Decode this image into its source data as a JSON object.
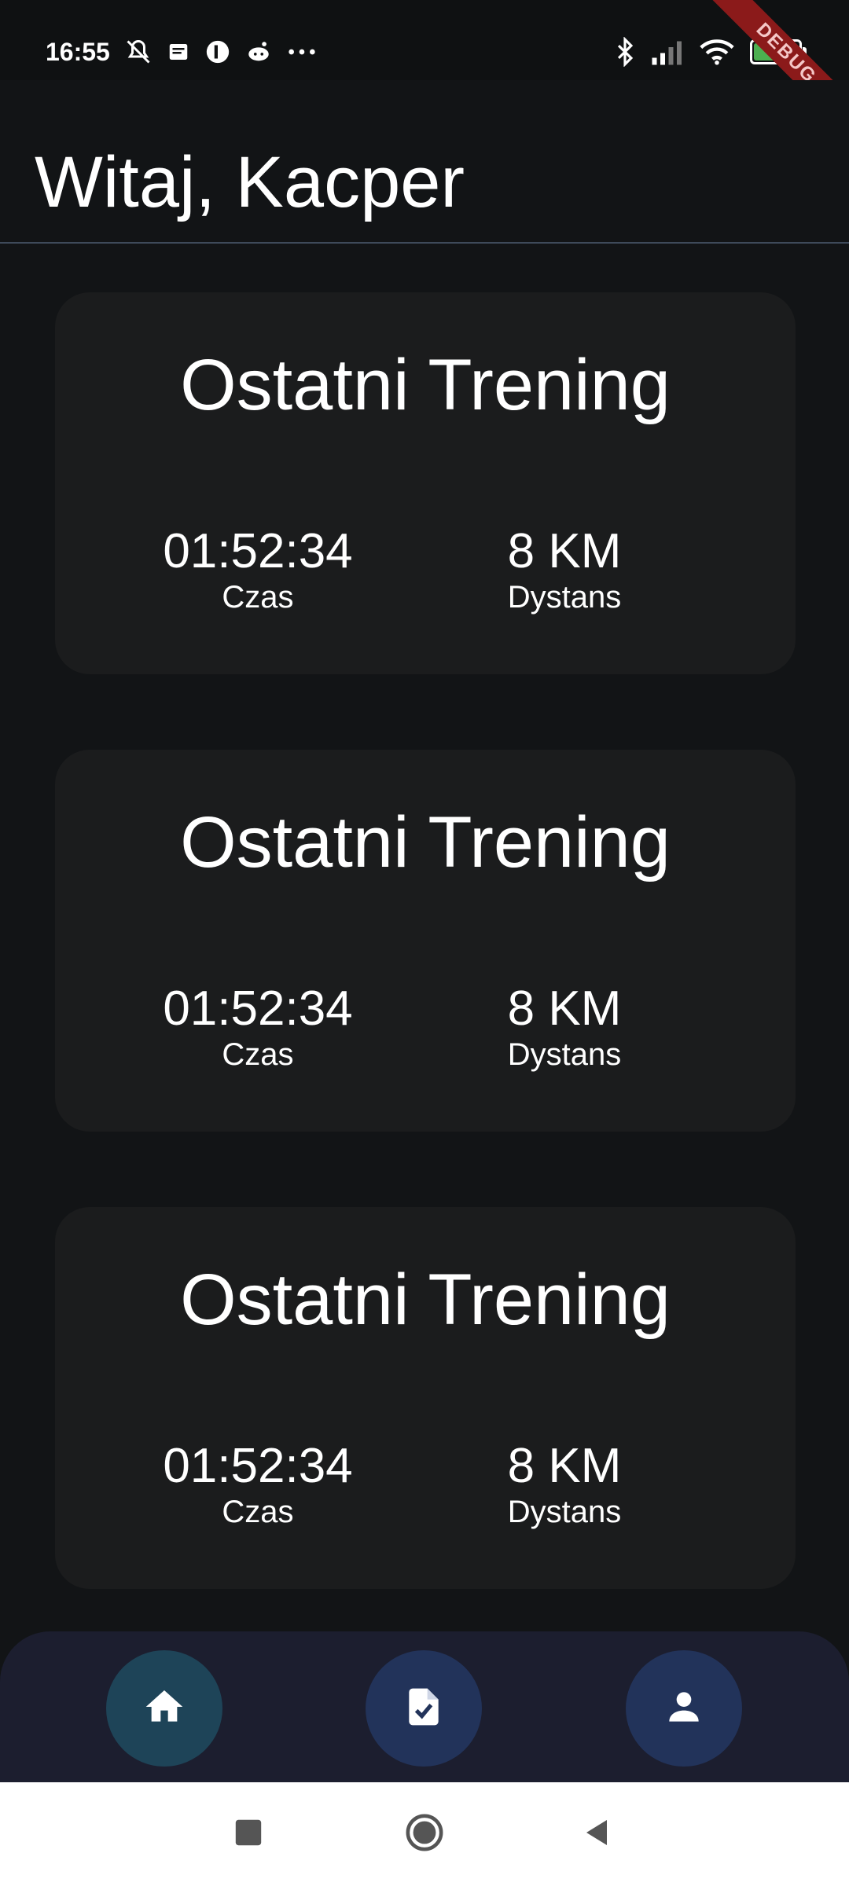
{
  "status_bar": {
    "time": "16:55",
    "battery_text": "92",
    "battery_level": 0.92,
    "left_icons": [
      "muted-bell-icon",
      "message-icon",
      "app-circle-icon",
      "reddit-icon",
      "more-dots-icon"
    ],
    "right_icons": [
      "bluetooth-icon",
      "signal-icon",
      "wifi-icon",
      "battery-icon"
    ]
  },
  "debug_banner": "DEBUG",
  "app_bar": {
    "title": "Witaj, Kacper"
  },
  "cards": [
    {
      "title": "Ostatni Trening",
      "time_value": "01:52:34",
      "time_label": "Czas",
      "distance_value": "8 KM",
      "distance_label": "Dystans"
    },
    {
      "title": "Ostatni Trening",
      "time_value": "01:52:34",
      "time_label": "Czas",
      "distance_value": "8 KM",
      "distance_label": "Dystans"
    },
    {
      "title": "Ostatni Trening",
      "time_value": "01:52:34",
      "time_label": "Czas",
      "distance_value": "8 KM",
      "distance_label": "Dystans"
    }
  ],
  "bottom_nav": {
    "items": [
      {
        "icon": "home-icon",
        "active": true
      },
      {
        "icon": "task-document-icon",
        "active": false
      },
      {
        "icon": "person-icon",
        "active": false
      }
    ]
  },
  "colors": {
    "background": "#121416",
    "card": "#1b1c1d",
    "nav_bar": "#1c1e2f",
    "nav_button": "#22335a",
    "nav_button_active": "#1e4458",
    "debug": "#8b1a1a"
  }
}
